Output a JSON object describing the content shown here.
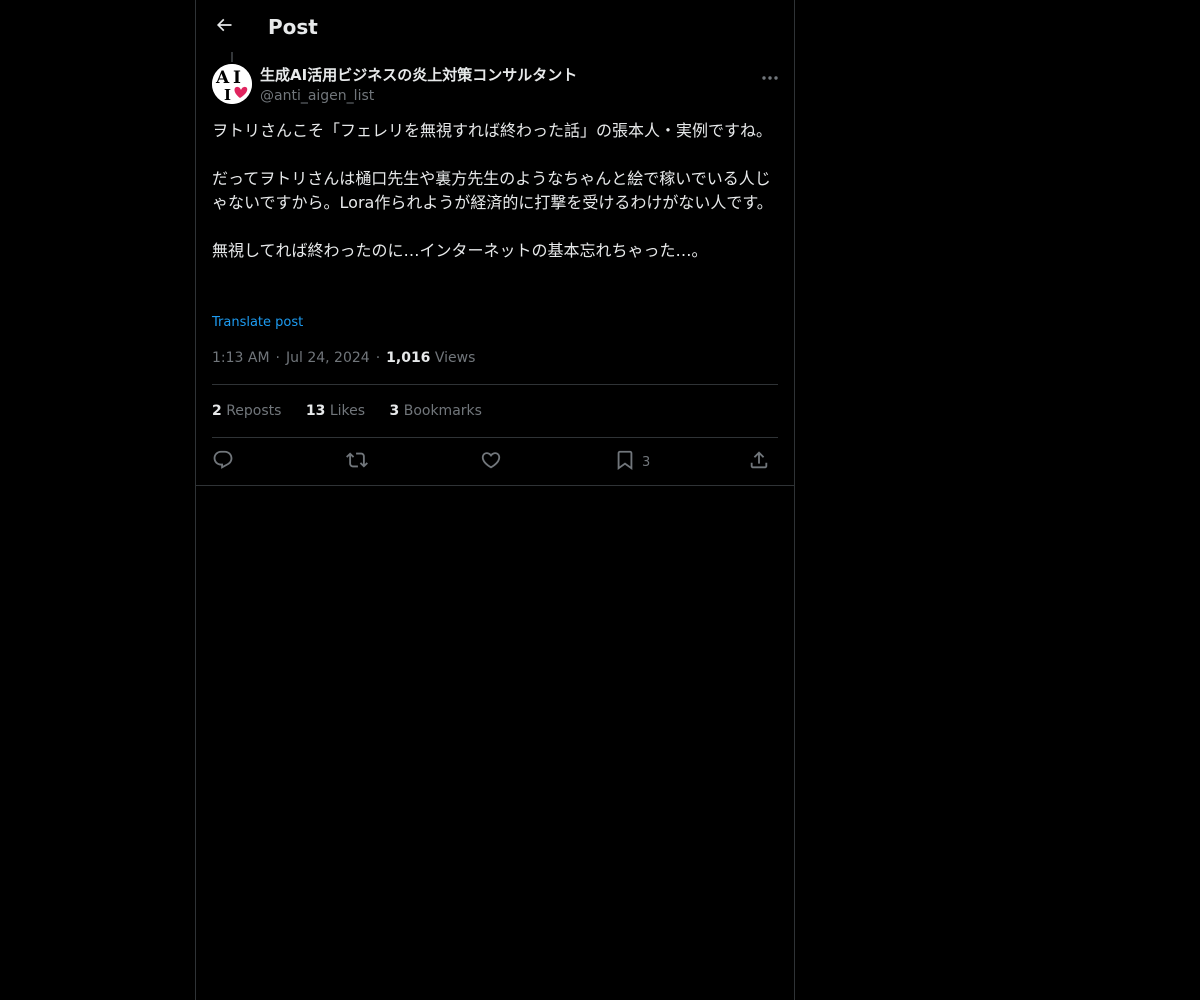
{
  "header": {
    "title": "Post"
  },
  "post": {
    "display_name": "生成AI活用ビジネスの炎上対策コンサルタント",
    "handle": "@anti_aigen_list",
    "paragraphs": [
      "ヲトリさんこそ「フェレリを無視すれば終わった話」の張本人・実例ですね。",
      "だってヲトリさんは樋口先生や裏方先生のようなちゃんと絵で稼いでいる人じゃないですから。Lora作られようが経済的に打撃を受けるわけがない人です。",
      "無視してれば終わったのに…インターネットの基本忘れちゃった…。"
    ],
    "translate_label": "Translate post",
    "time": "1:13 AM",
    "date": "Jul 24, 2024",
    "separator": "·",
    "views_count": "1,016",
    "views_label": "Views"
  },
  "stats": {
    "reposts_count": "2",
    "reposts_label": "Reposts",
    "likes_count": "13",
    "likes_label": "Likes",
    "bookmarks_count": "3",
    "bookmarks_label": "Bookmarks"
  },
  "actions": {
    "bookmark_count": "3"
  },
  "avatar": {
    "letters": "AI",
    "heart_color": "#e0245e"
  },
  "colors": {
    "background": "#000000",
    "text": "#e7e9ea",
    "muted": "#71767b",
    "link": "#1d9bf0",
    "border": "#2f3336"
  }
}
